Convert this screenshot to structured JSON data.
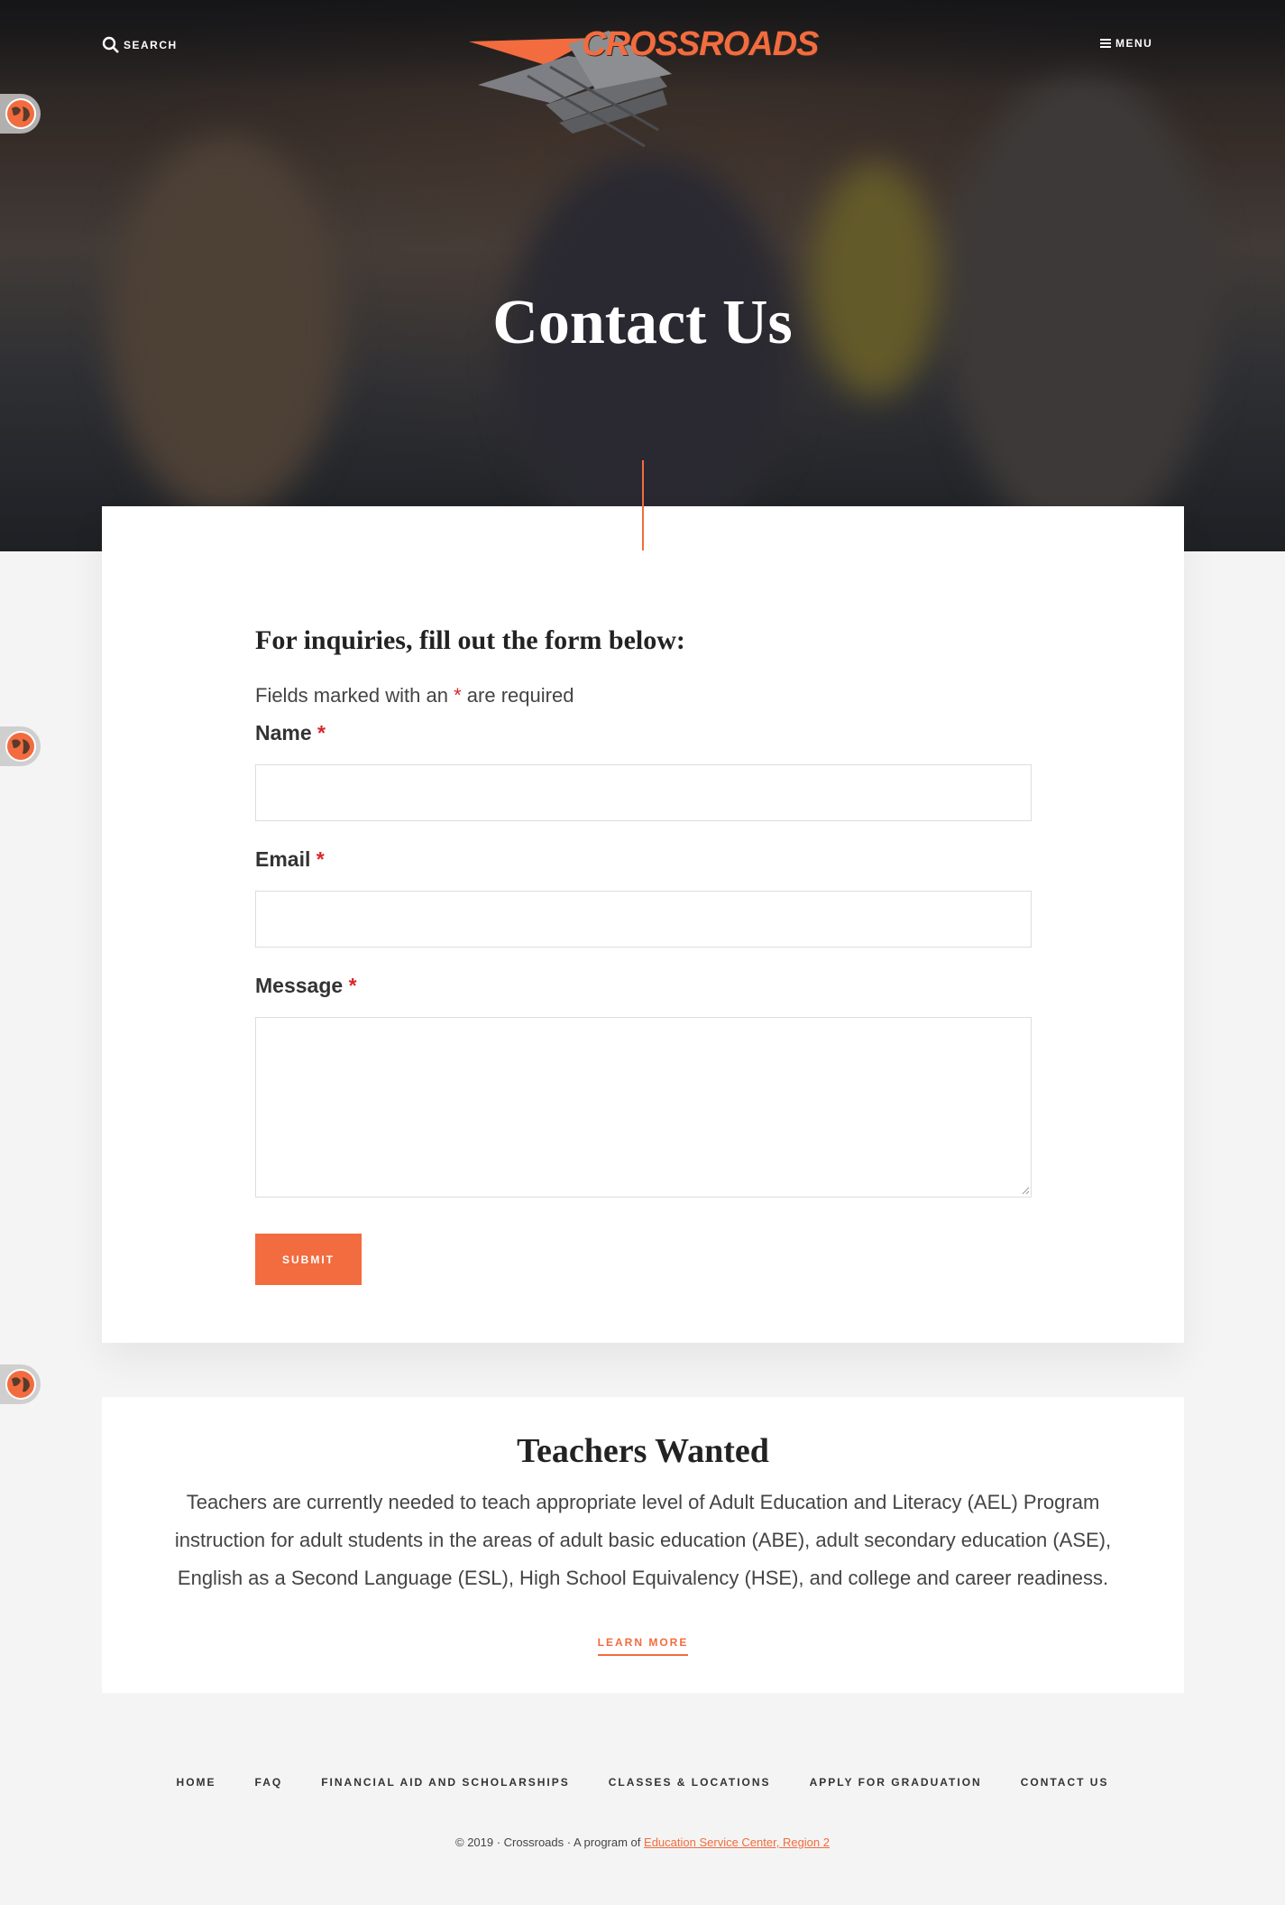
{
  "header": {
    "search_label": "SEARCH",
    "menu_label": "MENU",
    "logo_text": "CROSSROADS"
  },
  "hero": {
    "title": "Contact Us"
  },
  "form": {
    "intro": "For inquiries, fill out the form below:",
    "required_note_prefix": "Fields marked with an",
    "required_mark": "*",
    "required_note_suffix": "are required",
    "fields": [
      {
        "label": "Name",
        "value": ""
      },
      {
        "label": "Email",
        "value": ""
      },
      {
        "label": "Message",
        "value": ""
      }
    ],
    "submit_label": "SUBMIT"
  },
  "teachers": {
    "title": "Teachers Wanted",
    "body": "Teachers are currently needed to teach appropriate level of Adult Education and Literacy (AEL) Program instruction for adult students in the areas of adult basic education (ABE), adult secondary education (ASE), English as a Second Language (ESL), High School Equivalency (HSE), and college and career readiness.",
    "cta_label": "LEARN MORE"
  },
  "footer": {
    "nav": [
      "HOME",
      "FAQ",
      "FINANCIAL AID AND SCHOLARSHIPS",
      "CLASSES & LOCATIONS",
      "APPLY FOR GRADUATION",
      "CONTACT US"
    ],
    "copyright": "© 2019 · Crossroads · A program of",
    "org_link": "Education Service Center, Region 2"
  },
  "colors": {
    "accent": "#f26c3f",
    "required": "#d9262c",
    "page_bg": "#f4f4f4"
  },
  "icons": [
    "search-icon",
    "menu-icon",
    "globe-icon",
    "resize-grip-icon"
  ]
}
